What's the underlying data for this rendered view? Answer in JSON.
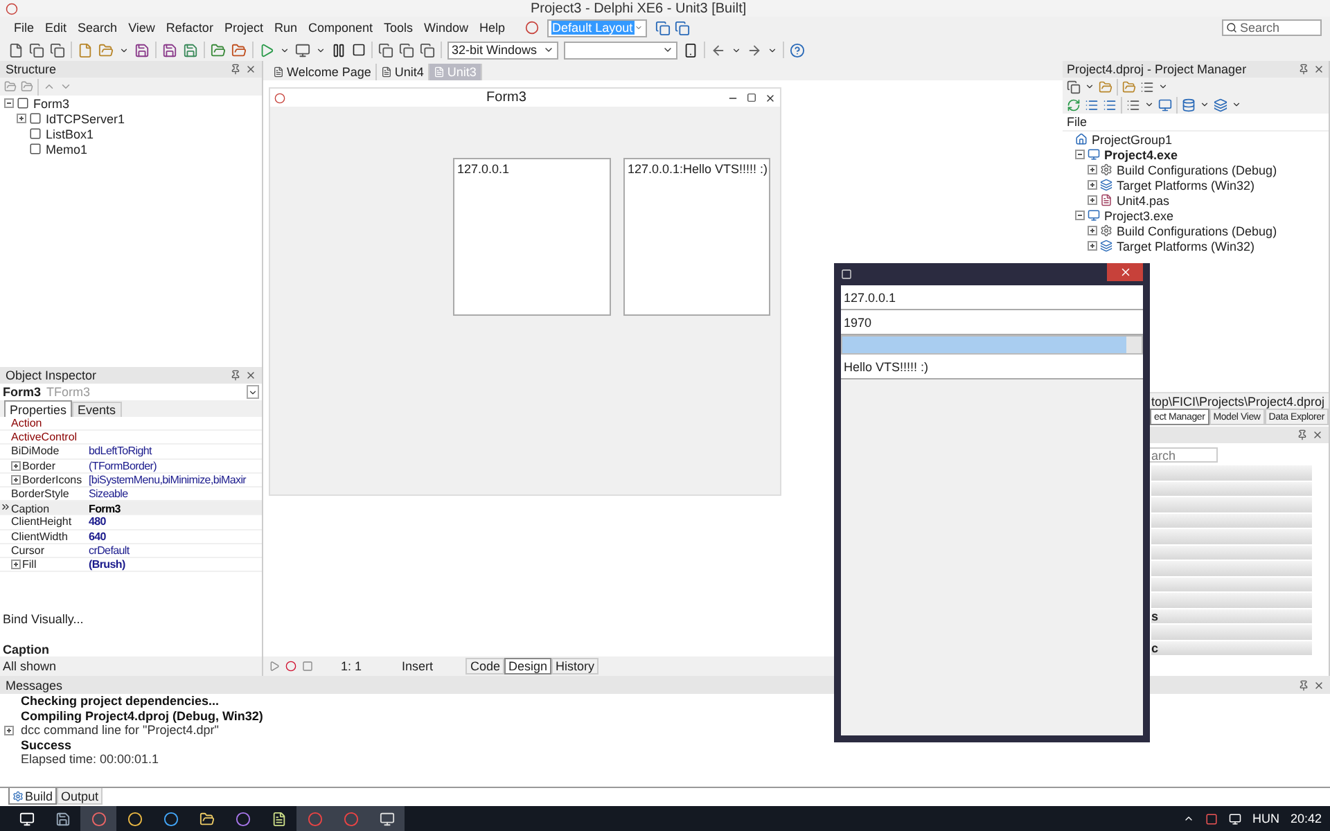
{
  "window": {
    "title": "Project3 - Delphi XE6 - Unit3 [Built]"
  },
  "menu": [
    "File",
    "Edit",
    "Search",
    "View",
    "Refactor",
    "Project",
    "Run",
    "Component",
    "Tools",
    "Window",
    "Help"
  ],
  "layout_combo": {
    "value": "Default Layout"
  },
  "search": {
    "placeholder": "Search"
  },
  "platform_combo": {
    "value": "32-bit Windows"
  },
  "structure": {
    "title": "Structure",
    "tree": [
      {
        "label": "Form3",
        "expanded": true,
        "children": [
          {
            "label": "IdTCPServer1",
            "expanded": false
          },
          {
            "label": "ListBox1"
          },
          {
            "label": "Memo1"
          }
        ]
      }
    ]
  },
  "object_inspector": {
    "title": "Object Inspector",
    "object_name": "Form3",
    "object_type": "TForm3",
    "tabs": [
      {
        "label": "Properties",
        "selected": true
      },
      {
        "label": "Events",
        "selected": false
      }
    ],
    "properties": [
      {
        "name": "Action",
        "kind": "linked",
        "selected": false
      },
      {
        "name": "ActiveControl",
        "kind": "linked",
        "selected": false
      },
      {
        "name": "BiDiMode",
        "value": "bdLeftToRight",
        "kind": "normal",
        "selected": false
      },
      {
        "name": "Border",
        "value": "(TFormBorder)",
        "kind": "normal",
        "expanded": false,
        "selected": false
      },
      {
        "name": "BorderIcons",
        "value": "[biSystemMenu,biMinimize,biMaxir",
        "kind": "normal",
        "expanded": false,
        "selected": false
      },
      {
        "name": "BorderStyle",
        "value": "Sizeable",
        "kind": "normal",
        "selected": false
      },
      {
        "name": "Caption",
        "value": "Form3",
        "kind": "normal",
        "bold": true,
        "selected": true
      },
      {
        "name": "ClientHeight",
        "value": "480",
        "kind": "normal",
        "bold": true,
        "selected": false
      },
      {
        "name": "ClientWidth",
        "value": "640",
        "kind": "normal",
        "bold": true,
        "selected": false
      },
      {
        "name": "Cursor",
        "value": "crDefault",
        "kind": "normal",
        "selected": false
      },
      {
        "name": "Fill",
        "value": "(Brush)",
        "kind": "normal",
        "bold": true,
        "expanded": false,
        "selected": false
      }
    ],
    "bind_link": "Bind Visually...",
    "description_title": "Caption",
    "filter": "All shown"
  },
  "editor": {
    "tabs": [
      {
        "label": "Welcome Page",
        "selected": false
      },
      {
        "label": "Unit4",
        "selected": false
      },
      {
        "label": "Unit3",
        "selected": true
      }
    ],
    "form": {
      "title": "Form3",
      "listbox_items": [
        "127.0.0.1"
      ],
      "memo_lines": [
        "127.0.0.1:Hello VTS!!!!! :)"
      ]
    },
    "status": {
      "position": "1: 1",
      "mode": "Insert"
    },
    "view_tabs": [
      {
        "label": "Code",
        "selected": false
      },
      {
        "label": "Design",
        "selected": true
      },
      {
        "label": "History",
        "selected": false
      }
    ]
  },
  "project_manager": {
    "title": "Project4.dproj - Project Manager",
    "column": "File",
    "tree": [
      {
        "label": "ProjectGroup1",
        "kind": "group",
        "children": [
          {
            "label": "Project4.exe",
            "kind": "project",
            "active": true,
            "expanded": true,
            "children": [
              {
                "label": "Build Configurations (Debug)",
                "kind": "config",
                "expanded": false
              },
              {
                "label": "Target Platforms (Win32)",
                "kind": "platform",
                "expanded": false
              },
              {
                "label": "Unit4.pas",
                "kind": "unit",
                "expanded": false
              }
            ]
          },
          {
            "label": "Project3.exe",
            "kind": "project",
            "active": false,
            "expanded": true,
            "children": [
              {
                "label": "Build Configurations (Debug)",
                "kind": "config",
                "expanded": false
              },
              {
                "label": "Target Platforms (Win32)",
                "kind": "platform",
                "expanded": false
              }
            ]
          }
        ]
      }
    ],
    "path": "top\\FICI\\Projects\\Project4.dproj",
    "tabs": [
      {
        "label": "ect Manager",
        "selected": true
      },
      {
        "label": "Model View",
        "selected": false
      },
      {
        "label": "Data Explorer",
        "selected": false
      }
    ]
  },
  "palette": {
    "search_placeholder": "arch",
    "labels": [
      "s",
      "c"
    ]
  },
  "messages": {
    "title": "Messages",
    "lines": [
      {
        "text": "Checking project dependencies...",
        "bold": true
      },
      {
        "text": "Compiling Project4.dproj (Debug, Win32)",
        "bold": true
      },
      {
        "text": "dcc command line for \"Project4.dpr\"",
        "bold": false,
        "expanded": false
      },
      {
        "text": "Success",
        "bold": true
      },
      {
        "text": "Elapsed time: 00:00:01.1",
        "bold": false
      }
    ]
  },
  "bottom_tabs": [
    {
      "label": "Build",
      "selected": true
    },
    {
      "label": "Output",
      "selected": false
    }
  ],
  "app_window": {
    "fields": [
      {
        "kind": "edit",
        "value": "127.0.0.1"
      },
      {
        "kind": "edit",
        "value": "1970"
      },
      {
        "kind": "progress",
        "level": 0.95
      },
      {
        "kind": "edit",
        "value": "Hello VTS!!!!! :)"
      }
    ]
  },
  "taskbar": {
    "language": "HUN",
    "time": "20:42"
  }
}
